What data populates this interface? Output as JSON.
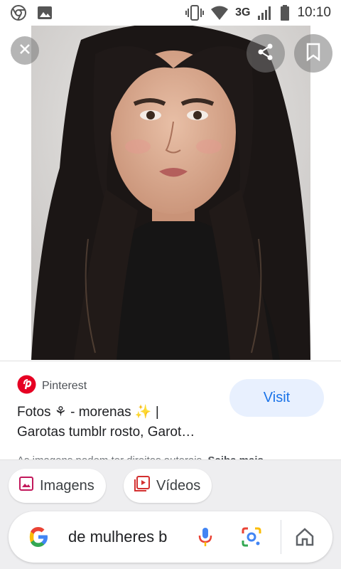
{
  "status_bar": {
    "network": "3G",
    "time": "10:10",
    "icons": [
      "chrome-icon",
      "gallery-icon",
      "vibrate-icon",
      "wifi-icon",
      "signal-icon",
      "battery-icon"
    ]
  },
  "viewer": {
    "close_icon": "close-icon",
    "share_icon": "share-icon",
    "save_icon": "bookmark-icon"
  },
  "result": {
    "source": "Pinterest",
    "title_line1": "Fotos ⚘ - morenas ✨ |",
    "title_line2": "Garotas tumblr rosto, Garot…",
    "visit_label": "Visit",
    "rights_text": "As imagens podem ter direitos autorais.",
    "rights_link": "Saiba mais"
  },
  "chips": {
    "images_label": "Imagens",
    "videos_label": "Vídeos"
  },
  "search": {
    "query": "de mulheres b"
  },
  "colors": {
    "accent_blue": "#1a73e8",
    "visit_bg": "#e8f0fe",
    "pinterest_red": "#e60023",
    "chip_icon_pink": "#c2185b",
    "chip_icon_red": "#d32f2f"
  }
}
